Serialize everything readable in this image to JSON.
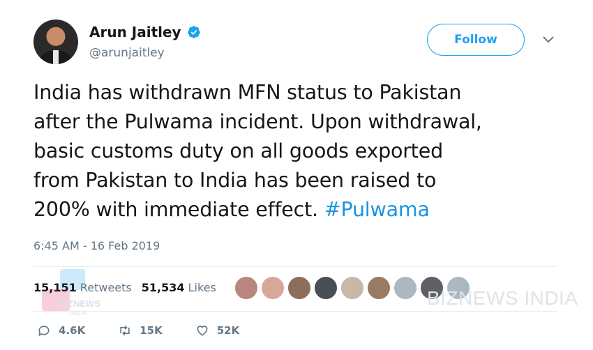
{
  "user": {
    "name": "Arun Jaitley",
    "handle": "@arunjaitley"
  },
  "follow_label": "Follow",
  "tweet": {
    "text": "India has withdrawn MFN status to Pakistan\nafter the Pulwama incident. Upon withdrawal,\nbasic customs duty on all goods exported\nfrom Pakistan to India has been raised to\n200% with immediate effect. ",
    "hashtag": "#Pulwama"
  },
  "timestamp": "6:45 AM - 16 Feb 2019",
  "stats": {
    "retweets_count": "15,151",
    "retweets_label": "Retweets",
    "likes_count": "51,534",
    "likes_label": "Likes"
  },
  "actions": {
    "replies": "4.6K",
    "retweets": "15K",
    "likes": "52K"
  },
  "watermark": {
    "text": "BIZNEWS INDIA",
    "logo_text": "BIZNEWS",
    "logo_sub": "INDIA"
  },
  "colors": {
    "accent": "#1da1f2",
    "hashtag": "#1b95e0",
    "muted": "#657786",
    "text": "#14171a"
  },
  "liker_colors": [
    "#b7867d",
    "#d9a79a",
    "#8c6e5a",
    "#4a4f56",
    "#c9b8a6",
    "#9a7b62",
    "#aab8c2",
    "#5d6166",
    "#aab8c2"
  ]
}
